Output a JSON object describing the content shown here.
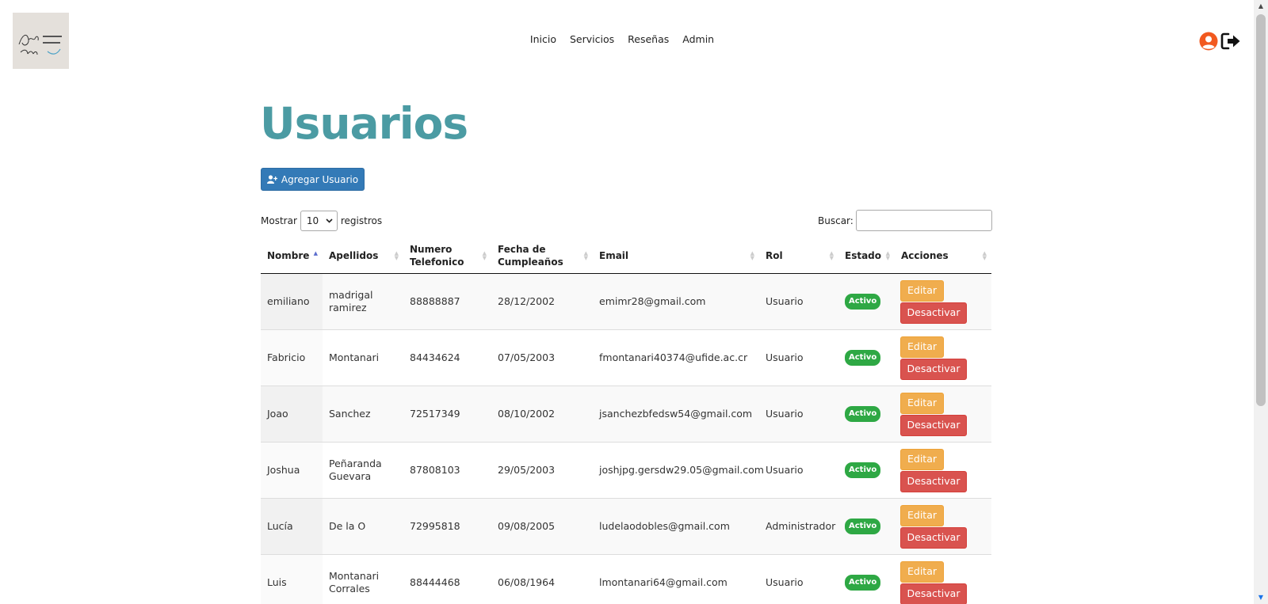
{
  "header": {
    "logo_alt": "Ana León",
    "nav": [
      "Inicio",
      "Servicios",
      "Reseñas",
      "Admin"
    ]
  },
  "page": {
    "title": "Usuarios",
    "add_button": "Agregar Usuario",
    "length_prefix": "Mostrar",
    "length_value": "10",
    "length_suffix": "registros",
    "search_label": "Buscar:",
    "search_value": ""
  },
  "table": {
    "columns": [
      "Nombre",
      "Apellidos",
      "Numero Telefonico",
      "Fecha de Cumpleaños",
      "Email",
      "Rol",
      "Estado",
      "Acciones"
    ],
    "sorted_column": "Nombre",
    "rows": [
      {
        "nombre": "emiliano",
        "apellidos": "madrigal ramirez",
        "telefono": "88888887",
        "fecha": "28/12/2002",
        "email": "emimr28@gmail.com",
        "rol": "Usuario",
        "estado": "Activo",
        "edit": "Editar",
        "deactivate": "Desactivar"
      },
      {
        "nombre": "Fabricio",
        "apellidos": "Montanari",
        "telefono": "84434624",
        "fecha": "07/05/2003",
        "email": "fmontanari40374@ufide.ac.cr",
        "rol": "Usuario",
        "estado": "Activo",
        "edit": "Editar",
        "deactivate": "Desactivar"
      },
      {
        "nombre": "Joao",
        "apellidos": "Sanchez",
        "telefono": "72517349",
        "fecha": "08/10/2002",
        "email": "jsanchezbfedsw54@gmail.com",
        "rol": "Usuario",
        "estado": "Activo",
        "edit": "Editar",
        "deactivate": "Desactivar"
      },
      {
        "nombre": "Joshua",
        "apellidos": "Peñaranda Guevara",
        "telefono": "87808103",
        "fecha": "29/05/2003",
        "email": "joshjpg.gersdw29.05@gmail.com",
        "rol": "Usuario",
        "estado": "Activo",
        "edit": "Editar",
        "deactivate": "Desactivar"
      },
      {
        "nombre": "Lucía",
        "apellidos": "De la O",
        "telefono": "72995818",
        "fecha": "09/08/2005",
        "email": "ludelaodobles@gmail.com",
        "rol": "Administrador",
        "estado": "Activo",
        "edit": "Editar",
        "deactivate": "Desactivar"
      },
      {
        "nombre": "Luis",
        "apellidos": "Montanari Corrales",
        "telefono": "88444468",
        "fecha": "06/08/1964",
        "email": "lmontanari64@gmail.com",
        "rol": "Usuario",
        "estado": "Activo",
        "edit": "Editar",
        "deactivate": "Desactivar"
      }
    ]
  },
  "colors": {
    "title": "#4b9ba3",
    "primary": "#337ab7",
    "warning": "#f0ad4e",
    "danger": "#d9534f",
    "success": "#2ea844",
    "user_icon": "#f2591f"
  },
  "icons": [
    "user-circle-icon",
    "logout-icon",
    "user-plus-icon",
    "sort-icon"
  ]
}
